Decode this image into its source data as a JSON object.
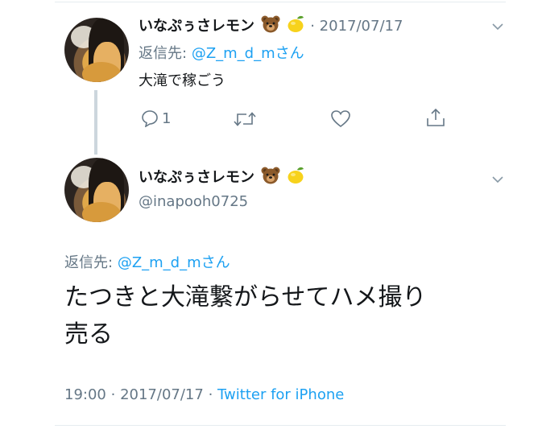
{
  "reply_tweet": {
    "display_name": "いなぷぅさレモン",
    "separator": "·",
    "date": "2017/07/17",
    "reply_prefix": "返信先:",
    "reply_handle": "@Z_m_d_mさん",
    "text": "大滝で稼ごう",
    "reply_count": "1",
    "emoji": [
      "bear-face",
      "lemon"
    ]
  },
  "main_tweet": {
    "display_name": "いなぷぅさレモン",
    "handle": "@inapooh0725",
    "reply_prefix": "返信先:",
    "reply_handle": "@Z_m_d_mさん",
    "text_line1": "たつきと大滝繋がらせてハメ撮り",
    "text_line2": "売る",
    "time": "19:00",
    "sep1": "·",
    "date": "2017/07/17",
    "sep2": "·",
    "source": "Twitter for iPhone"
  },
  "colors": {
    "link": "#1da1f2",
    "secondary": "#657786",
    "text": "#14171a",
    "divider": "#e6ecf0"
  }
}
